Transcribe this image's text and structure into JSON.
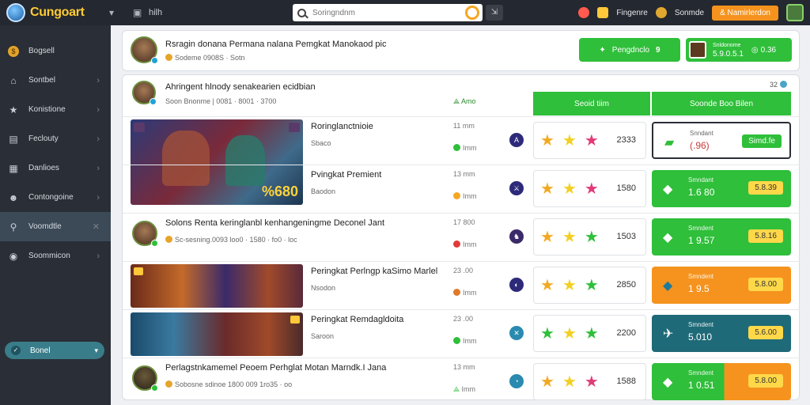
{
  "app": {
    "logo_text": "Cungoart",
    "nav_icon_label": "▾",
    "shortcut_label": "hilh"
  },
  "search": {
    "placeholder": "Soringndnm"
  },
  "topbar_right": {
    "item1": "Fingenre",
    "item2": "Sonmde",
    "deposit": "& Namirlerdon"
  },
  "sidebar": {
    "items": [
      {
        "label": "Bogsell",
        "icon": "coin-icon"
      },
      {
        "label": "Sontbel",
        "icon": "home-icon"
      },
      {
        "label": "Konistione",
        "icon": "star-icon"
      },
      {
        "label": "Feclouty",
        "icon": "inbox-icon"
      },
      {
        "label": "Danlioes",
        "icon": "calendar-icon"
      },
      {
        "label": "Contongoine",
        "icon": "people-icon"
      },
      {
        "label": "Voomdtle",
        "icon": "key-icon"
      },
      {
        "label": "Soommicon",
        "icon": "settings-icon"
      }
    ],
    "bottom": "Bonel"
  },
  "top_panel": {
    "title": "Rsragin donana Permana nalana Pemgkat Manokaod pic",
    "sub": "Sodeme 0908S · Sotn",
    "btn_label": "Pengdnclo",
    "btn_value": "9",
    "card_l1": "Snldonome",
    "card_l2": "5.9.0.5.1",
    "card_value": "0.36"
  },
  "list_header": {
    "title": "Ahringent hlnody senakearien ecidbian",
    "sub": "Soon Bnonme |  0081 · 8001 · 3700",
    "tag": "Amo",
    "tab1": "Seoid tiim",
    "tab2": "Soonde Boo Bilen",
    "corner": "32"
  },
  "rows": [
    {
      "title": "Roringlanctnioie",
      "sub": "Sbaco",
      "time": "11 mm",
      "time2": "Imm",
      "icon_color": "#2d2a7a",
      "score": "2333",
      "odds_label": "Snndant",
      "odds_value": "(.96)",
      "pill": "Simd.fe"
    },
    {
      "title": "Pvingkat Premient",
      "sub": "Baodon",
      "time": "13 mm",
      "time2": "Imm",
      "icon_color": "#2d2a7a",
      "score": "1580",
      "odds_label": "Smndant",
      "odds_value": "1.6 80",
      "pill": "5.8.39"
    },
    {
      "title": "Solons Renta keringlanbl kenhangeningme Deconel Jant",
      "sub": "Sc-sesning.0093 loo0 · 1580 · fo0 · loc",
      "time": "17 800",
      "time2": "Imm",
      "icon_color": "#3b2a6a",
      "score": "1503",
      "odds_label": "Smndent",
      "odds_value": "1 9.57",
      "pill": "5.8.16"
    },
    {
      "title": "Peringkat Perlngp kaSimo Marlel",
      "sub": "Nsodon",
      "time": "23 .00",
      "time2": "Imm",
      "icon_color": "#2d2a7a",
      "score": "2850",
      "odds_label": "Smndent",
      "odds_value": "1 9.5",
      "pill": "5.8.00"
    },
    {
      "title": "Peringkat Remdagldoita",
      "sub": "Saroon",
      "time": "23 .00",
      "time2": "Imm",
      "icon_color": "#2a8ab0",
      "score": "2200",
      "odds_label": "Smndent",
      "odds_value": "5.010",
      "pill": "5.6.00"
    },
    {
      "title": "Perlagstnkamemel Peoem Perhglat Motan Marndk.I Jana",
      "sub": "Sobosne sdinoe 1800 009 1ro35 ·  oo",
      "time": "13 mm",
      "time2": "Imm",
      "icon_color": "#2a8ab0",
      "score": "1588",
      "odds_label": "Smndent",
      "odds_value": "1 0.51",
      "pill": "5.8.00"
    }
  ]
}
